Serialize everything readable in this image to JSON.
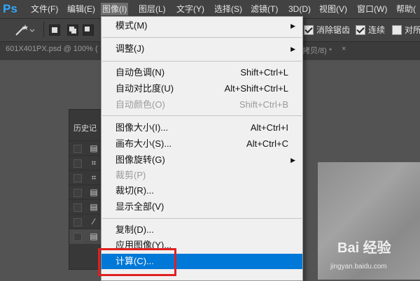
{
  "app": {
    "logo": "Ps"
  },
  "menubar": [
    {
      "label": "文件(F)"
    },
    {
      "label": "编辑(E)"
    },
    {
      "label": "图像(I)",
      "active": true
    },
    {
      "label": "图层(L)"
    },
    {
      "label": "文字(Y)"
    },
    {
      "label": "选择(S)"
    },
    {
      "label": "滤镜(T)"
    },
    {
      "label": "3D(D)"
    },
    {
      "label": "视图(V)"
    },
    {
      "label": "窗口(W)"
    },
    {
      "label": "帮助("
    }
  ],
  "options_bar": {
    "tool_icon": "magic-wand-icon",
    "antialias_label": "消除锯齿",
    "antialias_checked": true,
    "contiguous_label": "连续",
    "contiguous_checked": true,
    "sample_all_label": "对所",
    "sample_all_checked": false
  },
  "tabs": {
    "doc1": "601X401PX.psd @ 100% (",
    "doc2": "拷贝/8) *",
    "close": "×"
  },
  "history_panel": {
    "title": "历史记",
    "rows": [
      {
        "icon": "document-icon"
      },
      {
        "icon": "crop-icon"
      },
      {
        "icon": "crop-icon"
      },
      {
        "icon": "document-icon"
      },
      {
        "icon": "document-icon"
      },
      {
        "icon": "magic-wand-icon"
      },
      {
        "icon": "document-icon",
        "selected": true
      }
    ]
  },
  "image_menu": {
    "items": [
      {
        "label": "模式(M)",
        "submenu": true
      },
      {
        "separator": true
      },
      {
        "label": "调整(J)",
        "submenu": true
      },
      {
        "separator": true
      },
      {
        "label": "自动色调(N)",
        "shortcut": "Shift+Ctrl+L"
      },
      {
        "label": "自动对比度(U)",
        "shortcut": "Alt+Shift+Ctrl+L"
      },
      {
        "label": "自动颜色(O)",
        "shortcut": "Shift+Ctrl+B",
        "disabled": true
      },
      {
        "separator": true
      },
      {
        "label": "图像大小(I)...",
        "shortcut": "Alt+Ctrl+I"
      },
      {
        "label": "画布大小(S)...",
        "shortcut": "Alt+Ctrl+C"
      },
      {
        "label": "图像旋转(G)",
        "submenu": true
      },
      {
        "label": "裁剪(P)",
        "disabled": true
      },
      {
        "label": "裁切(R)..."
      },
      {
        "label": "显示全部(V)"
      },
      {
        "separator": true
      },
      {
        "label": "复制(D)..."
      },
      {
        "label": "应用图像(Y)..."
      },
      {
        "label": "计算(C)...",
        "highlighted": true
      }
    ]
  },
  "watermark": {
    "main": "Bai 经验",
    "url": "jingyan.baidu.com"
  },
  "colors": {
    "highlight": "#0078d7",
    "callout": "#e02020",
    "ps_blue": "#31a8ff"
  }
}
